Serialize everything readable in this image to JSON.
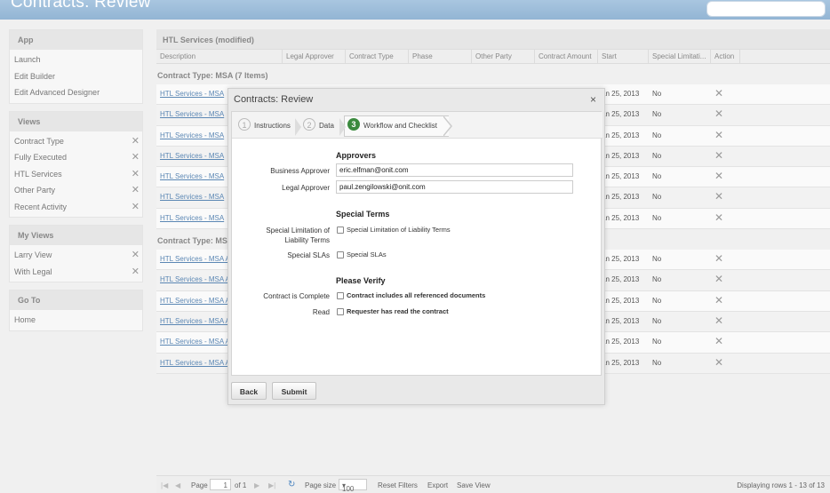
{
  "app": {
    "title": "Contracts: Review"
  },
  "sidebar": {
    "sections": [
      {
        "header": "App",
        "items": [
          {
            "label": "Launch",
            "removable": false
          },
          {
            "label": "Edit Builder",
            "removable": false
          },
          {
            "label": "Edit Advanced Designer",
            "removable": false
          }
        ]
      },
      {
        "header": "Views",
        "items": [
          {
            "label": "Contract Type",
            "removable": true
          },
          {
            "label": "Fully Executed",
            "removable": true
          },
          {
            "label": "HTL Services",
            "removable": true
          },
          {
            "label": "Other Party",
            "removable": true
          },
          {
            "label": "Recent Activity",
            "removable": true
          }
        ]
      },
      {
        "header": "My Views",
        "items": [
          {
            "label": "Larry View",
            "removable": true
          },
          {
            "label": "With Legal",
            "removable": true
          }
        ]
      },
      {
        "header": "Go To",
        "items": [
          {
            "label": "Home",
            "removable": false
          }
        ]
      }
    ]
  },
  "grid": {
    "title": "HTL Services (modified)",
    "columns": [
      "Description",
      "Legal Approver",
      "Contract Type",
      "Phase",
      "Other Party",
      "Contract Amount",
      "Start",
      "Special Limitati...",
      "Action"
    ],
    "groups": [
      {
        "title": "Contract Type: MSA (7 Items)",
        "rows": [
          {
            "description": "HTL Services - MSA",
            "start": "an 25, 2013",
            "special": "No"
          },
          {
            "description": "HTL Services - MSA",
            "start": "an 25, 2013",
            "special": "No"
          },
          {
            "description": "HTL Services - MSA",
            "start": "an 25, 2013",
            "special": "No"
          },
          {
            "description": "HTL Services - MSA",
            "start": "an 25, 2013",
            "special": "No"
          },
          {
            "description": "HTL Services - MSA",
            "start": "an 25, 2013",
            "special": "No"
          },
          {
            "description": "HTL Services - MSA",
            "start": "an 25, 2013",
            "special": "No"
          },
          {
            "description": "HTL Services - MSA",
            "start": "an 25, 2013",
            "special": "No"
          }
        ]
      },
      {
        "title": "Contract Type: MSA",
        "rows": [
          {
            "description": "HTL Services - MSA A",
            "start": "an 25, 2013",
            "special": "No"
          },
          {
            "description": "HTL Services - MSA A",
            "start": "an 25, 2013",
            "special": "No"
          },
          {
            "description": "HTL Services - MSA A",
            "start": "an 25, 2013",
            "special": "No"
          },
          {
            "description": "HTL Services - MSA A",
            "start": "an 25, 2013",
            "special": "No"
          },
          {
            "description": "HTL Services - MSA A",
            "start": "an 25, 2013",
            "special": "No"
          },
          {
            "description": "HTL Services - MSA A",
            "start": "an 25, 2013",
            "special": "No"
          }
        ]
      }
    ]
  },
  "pager": {
    "page_label": "Page",
    "page_value": "1",
    "of_label": "of 1",
    "page_size_label": "Page size",
    "page_size_value": "100",
    "reset_filters": "Reset Filters",
    "export": "Export",
    "save_view": "Save View",
    "status": "Displaying rows 1 - 13 of 13"
  },
  "modal": {
    "title": "Contracts: Review",
    "close_glyph": "×",
    "tabs": [
      {
        "num": "1",
        "label": "Instructions",
        "active": false
      },
      {
        "num": "2",
        "label": "Data",
        "active": false
      },
      {
        "num": "3",
        "label": "Workflow and Checklist",
        "active": true
      }
    ],
    "approvers": {
      "title": "Approvers",
      "business_label": "Business Approver",
      "business_value": "eric.elfman@onit.com",
      "legal_label": "Legal Approver",
      "legal_value": "paul.zengilowski@onit.com"
    },
    "special_terms": {
      "title": "Special Terms",
      "limitation_label_1": "Special Limitation of",
      "limitation_label_2": "Liability Terms",
      "limitation_checkbox": "Special Limitation of Liability Terms",
      "slas_label": "Special SLAs",
      "slas_checkbox": "Special SLAs"
    },
    "verify": {
      "title": "Please Verify",
      "complete_label": "Contract is Complete",
      "complete_checkbox": "Contract includes all referenced documents",
      "read_label": "Read",
      "read_checkbox": "Requester has read the contract"
    },
    "buttons": {
      "back": "Back",
      "submit": "Submit"
    }
  }
}
